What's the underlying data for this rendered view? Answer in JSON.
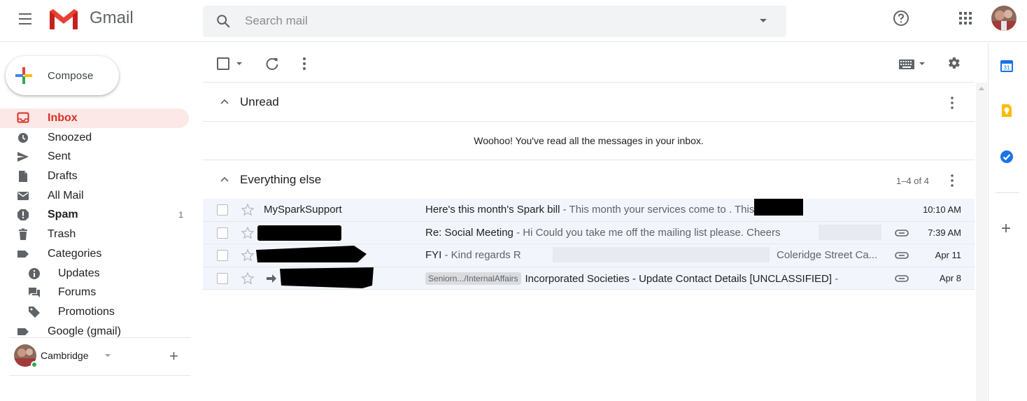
{
  "header": {
    "app_name": "Gmail",
    "search_placeholder": "Search mail"
  },
  "sidebar": {
    "compose_label": "Compose",
    "items": [
      {
        "label": "Inbox",
        "icon": "inbox-icon",
        "active": true,
        "count": ""
      },
      {
        "label": "Snoozed",
        "icon": "clock-icon",
        "count": ""
      },
      {
        "label": "Sent",
        "icon": "send-icon",
        "count": ""
      },
      {
        "label": "Drafts",
        "icon": "draft-icon",
        "count": ""
      },
      {
        "label": "All Mail",
        "icon": "mail-icon",
        "count": ""
      },
      {
        "label": "Spam",
        "icon": "spam-icon",
        "count": "1",
        "bold": true
      },
      {
        "label": "Trash",
        "icon": "trash-icon",
        "count": ""
      },
      {
        "label": "Categories",
        "icon": "label-icon",
        "count": ""
      },
      {
        "label": "Updates",
        "icon": "info-icon",
        "count": "",
        "sub": true
      },
      {
        "label": "Forums",
        "icon": "forum-icon",
        "count": "",
        "sub": true
      },
      {
        "label": "Promotions",
        "icon": "tag-icon",
        "count": "",
        "sub": true
      },
      {
        "label": "Google (gmail)",
        "icon": "label-icon",
        "count": ""
      }
    ],
    "hangouts_user": "Cambridge"
  },
  "sections": {
    "unread": {
      "title": "Unread",
      "empty_message": "Woohoo! You've read all the messages in your inbox."
    },
    "everything_else": {
      "title": "Everything else",
      "count": "1–4 of 4"
    }
  },
  "emails": [
    {
      "sender": "MySparkSupport",
      "label": "",
      "subject": "Here's this month's Spark bill",
      "snippet": " - This month your services come to             . This amount ...",
      "time": "10:10 AM",
      "attachment": false
    },
    {
      "sender": "",
      "label": "",
      "subject": "Re: Social Meeting",
      "snippet": " - Hi Could you take me off the mailing list please. Cheers",
      "time": "7:39 AM",
      "attachment": true
    },
    {
      "sender": "t.",
      "label": "",
      "subject": "FYI",
      "snippet": " - Kind regards R",
      "snippet_tail": "Coleridge Street Ca...",
      "time": "Apr 11",
      "attachment": true
    },
    {
      "sender": "",
      "label": "Seniorn.../InternalAffairs",
      "subject": "Incorporated Societies - Update Contact Details [UNCLASSIFIED]",
      "snippet": " -",
      "time": "Apr 8",
      "attachment": true
    }
  ],
  "colors": {
    "brand_red": "#d93025",
    "active_bg": "#fce8e6",
    "row_bg": "#f2f6fc"
  }
}
